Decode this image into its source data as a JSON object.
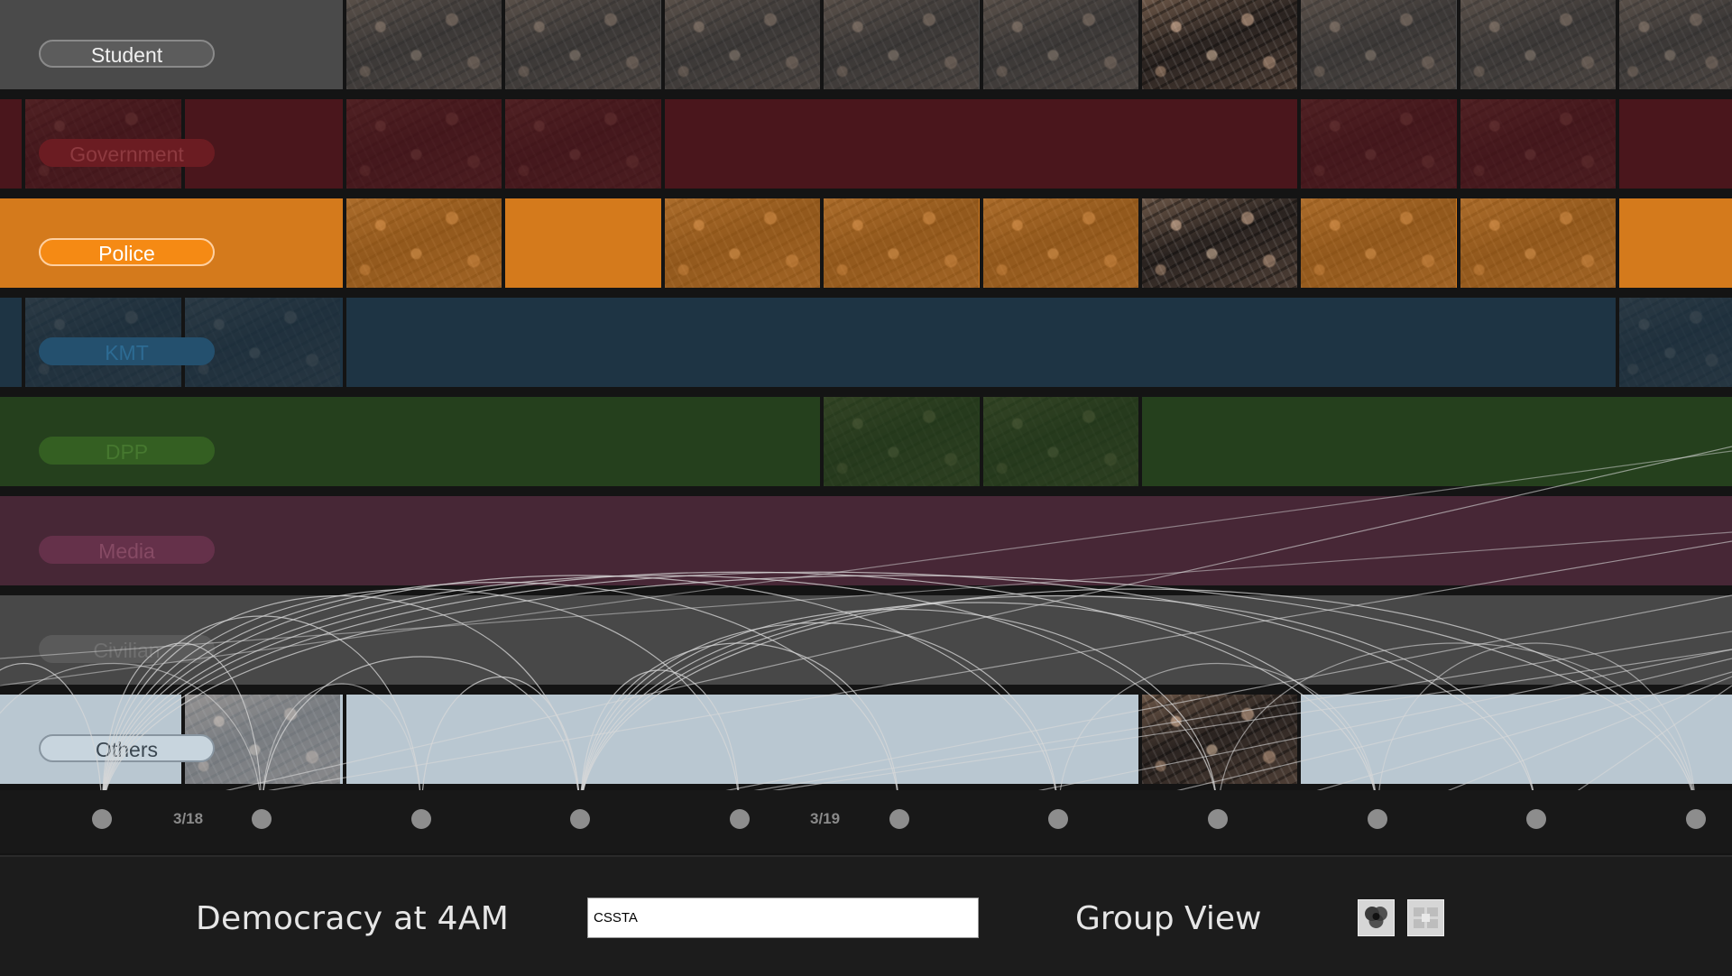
{
  "app": {
    "title": "Democracy at 4AM",
    "search_value": "CSSTA",
    "view_label": "Group View",
    "view_buttons": [
      {
        "name": "group-view-icon"
      },
      {
        "name": "timeline-view-icon"
      }
    ]
  },
  "groups": [
    {
      "label": "Student",
      "color": "#4a4a4a",
      "pill_bg": "#5c5c5c",
      "pill_border": "#8a8a8a",
      "text": "#f0f0f0",
      "active": true
    },
    {
      "label": "Government",
      "color": "#4a161c",
      "pill_bg": "#6b1c22",
      "pill_border": "#6b1c22",
      "text": "#8e3a40",
      "active": false
    },
    {
      "label": "Police",
      "color": "#d47a1c",
      "pill_bg": "#f58a14",
      "pill_border": "#ffd0a0",
      "text": "#ffffff",
      "active": true
    },
    {
      "label": "KMT",
      "color": "#1e3444",
      "pill_bg": "#24506e",
      "pill_border": "#24506e",
      "text": "#2d6b93",
      "active": false
    },
    {
      "label": "DPP",
      "color": "#25401d",
      "pill_bg": "#345f22",
      "pill_border": "#345f22",
      "text": "#46782f",
      "active": false
    },
    {
      "label": "Media",
      "color": "#472736",
      "pill_bg": "#65314a",
      "pill_border": "#65314a",
      "text": "#864a64",
      "active": false
    },
    {
      "label": "Civilian",
      "color": "#484848",
      "pill_bg": "#5a5a5a",
      "pill_border": "#5a5a5a",
      "text": "#707070",
      "active": false
    },
    {
      "label": "Others",
      "color": "#b9c7d1",
      "pill_bg": "#c8d5de",
      "pill_border": "#8895a0",
      "text": "#3a4650",
      "active": true
    }
  ],
  "timeline": {
    "dates": [
      {
        "label": "3/18"
      },
      {
        "label": "3/19"
      }
    ],
    "node_count": 11
  }
}
